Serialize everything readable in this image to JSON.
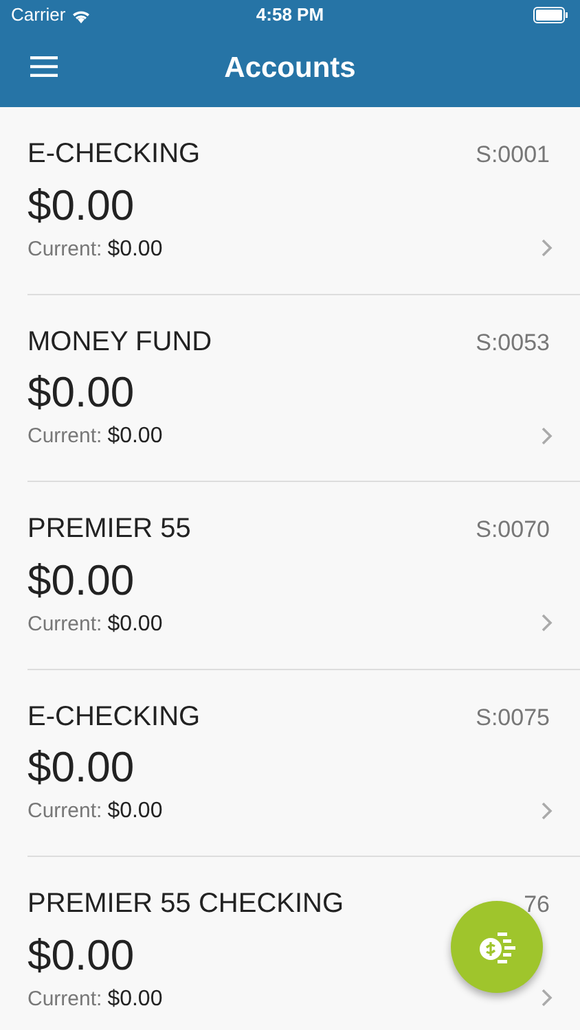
{
  "status_bar": {
    "carrier": "Carrier",
    "time": "4:58 PM"
  },
  "header": {
    "title": "Accounts"
  },
  "accounts": [
    {
      "name": "E-CHECKING",
      "number": "S:0001",
      "balance": "$0.00",
      "current_label": "Current:",
      "current_value": "$0.00"
    },
    {
      "name": "MONEY FUND",
      "number": "S:0053",
      "balance": "$0.00",
      "current_label": "Current:",
      "current_value": "$0.00"
    },
    {
      "name": "PREMIER 55",
      "number": "S:0070",
      "balance": "$0.00",
      "current_label": "Current:",
      "current_value": "$0.00"
    },
    {
      "name": "E-CHECKING",
      "number": "S:0075",
      "balance": "$0.00",
      "current_label": "Current:",
      "current_value": "$0.00"
    },
    {
      "name": "PREMIER 55 CHECKING",
      "number": "76",
      "balance": "$0.00",
      "current_label": "Current:",
      "current_value": "$0.00"
    }
  ]
}
